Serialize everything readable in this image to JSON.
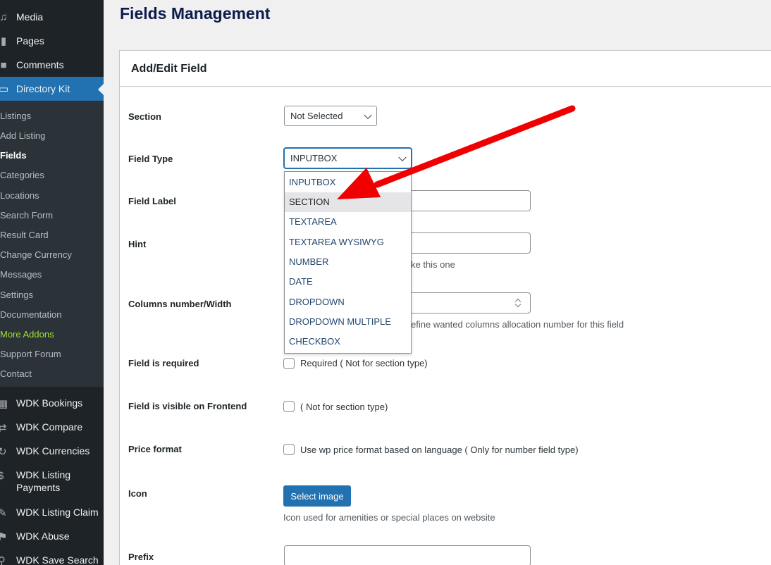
{
  "sidebar": {
    "top_items": [
      {
        "label": "Media",
        "icon": "media-icon"
      },
      {
        "label": "Pages",
        "icon": "pages-icon"
      },
      {
        "label": "Comments",
        "icon": "comments-icon"
      }
    ],
    "active_item": {
      "label": "Directory Kit",
      "icon": "folder-icon"
    },
    "submenu": [
      "Listings",
      "Add Listing",
      "Fields",
      "Categories",
      "Locations",
      "Search Form",
      "Result Card",
      "Change Currency",
      "Messages",
      "Settings",
      "Documentation",
      "More Addons",
      "Support Forum",
      "Contact"
    ],
    "submenu_current": "Fields",
    "bottom_items": [
      {
        "label": "WDK Bookings",
        "icon": "calendar-icon"
      },
      {
        "label": "WDK Compare",
        "icon": "compare-icon"
      },
      {
        "label": "WDK Currencies",
        "icon": "currencies-icon"
      },
      {
        "label": "WDK Listing Payments",
        "icon": "dollar-icon"
      },
      {
        "label": "WDK Listing Claim",
        "icon": "claim-icon"
      },
      {
        "label": "WDK Abuse",
        "icon": "flag-icon"
      },
      {
        "label": "WDK Save Search",
        "icon": "save-search-icon"
      }
    ]
  },
  "page": {
    "title": "Fields Management"
  },
  "panel": {
    "title": "Add/Edit Field"
  },
  "form": {
    "section": {
      "label": "Section",
      "value": "Not Selected"
    },
    "field_type": {
      "label": "Field Type",
      "value": "INPUTBOX"
    },
    "field_label": {
      "label": "Field Label"
    },
    "hint": {
      "label": "Hint",
      "desc_tail": "ke this one"
    },
    "columns": {
      "label": "Columns number/Width",
      "desc_tail": "efine wanted columns allocation number for this field"
    },
    "required": {
      "label": "Field is required",
      "checkbox": "Required ( Not for section type)"
    },
    "visible": {
      "label": "Field is visible on Frontend",
      "checkbox": "( Not for section type)"
    },
    "price": {
      "label": "Price format",
      "checkbox": "Use wp price format based on language ( Only for number field type)"
    },
    "icon": {
      "label": "Icon",
      "button": "Select image",
      "desc": "Icon used for amenities or special places on website"
    },
    "prefix": {
      "label": "Prefix"
    }
  },
  "dropdown": {
    "options": [
      "INPUTBOX",
      "SECTION",
      "TEXTAREA",
      "TEXTAREA WYSIWYG",
      "NUMBER",
      "DATE",
      "DROPDOWN",
      "DROPDOWN MULTIPLE",
      "CHECKBOX"
    ],
    "highlighted": "SECTION"
  },
  "colors": {
    "accent": "#2271b1",
    "sidebar": "#1d2327",
    "submenu": "#2c3338",
    "addon": "#9fe02f",
    "arrow": "#ff0000"
  }
}
